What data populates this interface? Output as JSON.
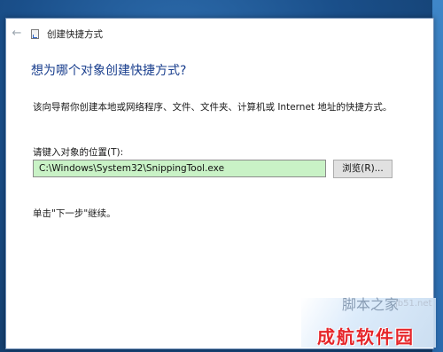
{
  "window": {
    "title": "创建快捷方式"
  },
  "wizard": {
    "heading": "想为哪个对象创建快捷方式?",
    "description": "该向导帮你创建本地或网络程序、文件、文件夹、计算机或 Internet 地址的快捷方式。",
    "location_label": "请键入对象的位置(T):",
    "location_value": "C:\\Windows\\System32\\SnippingTool.exe",
    "browse_label": "浏览(R)...",
    "hint": "单击\"下一步\"继续。"
  },
  "watermark": {
    "site_cn": "脚本之家",
    "site_url": "jb51.net",
    "brand": "成航软件园"
  },
  "colors": {
    "heading": "#1a3f8e",
    "input_bg": "#c9f2c6",
    "desktop": "#1d4f86",
    "watermark_red": "#e6262a"
  },
  "icons": {
    "back": "back-arrow-icon",
    "wizard": "shortcut-wizard-icon"
  }
}
